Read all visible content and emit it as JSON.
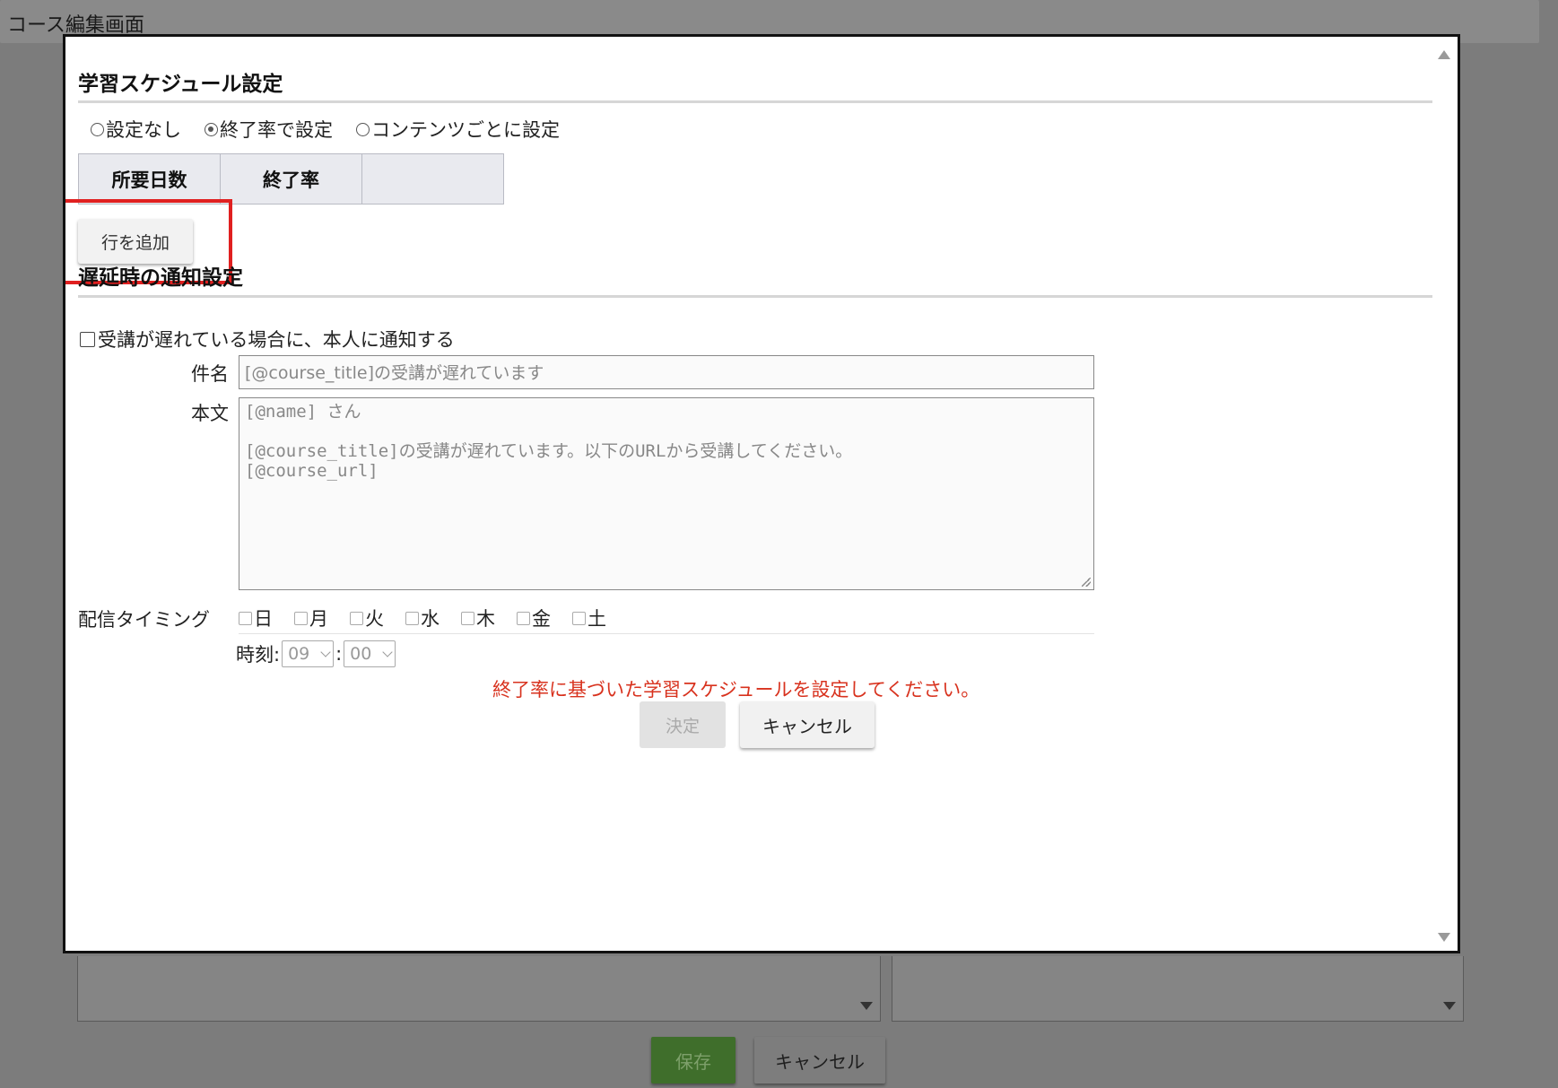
{
  "page": {
    "title": "コース編集画面",
    "save_label": "保存",
    "cancel_label": "キャンセル"
  },
  "modal": {
    "schedule": {
      "title": "学習スケジュール設定",
      "options": [
        {
          "label": "設定なし",
          "checked": false
        },
        {
          "label": "終了率で設定",
          "checked": true
        },
        {
          "label": "コンテンツごとに設定",
          "checked": false
        }
      ],
      "table_headers": [
        "所要日数",
        "終了率",
        ""
      ],
      "add_row_label": "行を追加"
    },
    "notify": {
      "title": "遅延時の通知設定",
      "checkbox_label": "受講が遅れている場合に、本人に通知する",
      "subject_label": "件名",
      "subject_value": "[@course_title]の受講が遅れています",
      "body_label": "本文",
      "body_value": "[@name] さん\n\n[@course_title]の受講が遅れています。以下のURLから受講してください。\n[@course_url]",
      "timing_label": "配信タイミング",
      "days": [
        "日",
        "月",
        "火",
        "水",
        "木",
        "金",
        "土"
      ],
      "time_label": "時刻:",
      "hour": "09",
      "minute": "00",
      "time_separator": ":"
    },
    "error": "終了率に基づいた学習スケジュールを設定してください。",
    "ok_label": "決定",
    "cancel_label": "キャンセル"
  },
  "colors": {
    "error": "#d8321e",
    "highlight": "#e02020",
    "save_button": "#3f6e2b"
  }
}
